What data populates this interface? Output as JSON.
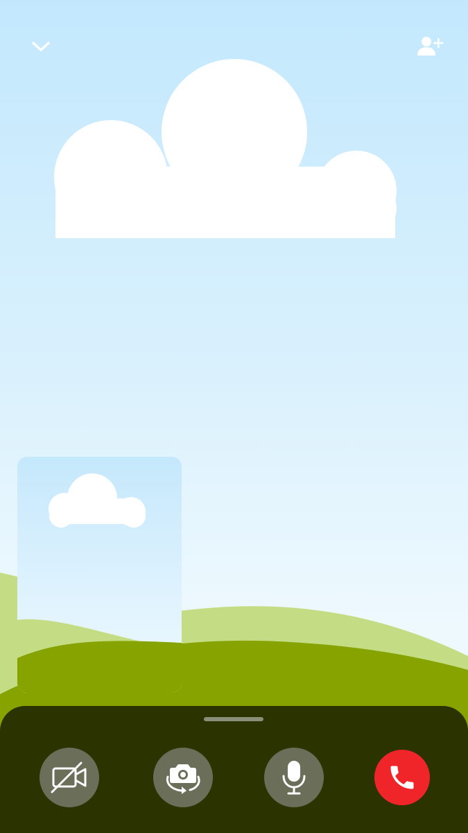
{
  "call": {
    "collapse_icon": "chevron-down-icon",
    "add_participant_icon": "add-person-icon"
  },
  "controls": [
    {
      "id": "camera",
      "icon": "camera-off-icon",
      "state": "off"
    },
    {
      "id": "flip",
      "icon": "flip-camera-icon"
    },
    {
      "id": "mic",
      "icon": "microphone-icon",
      "state": "on"
    },
    {
      "id": "end",
      "icon": "end-call-icon",
      "color": "#f0252a"
    }
  ],
  "colors": {
    "sheet": "#2b3301",
    "button": "#6b6e58",
    "end_call": "#f0252a",
    "sky_top": "#c3e8fd",
    "hill_light": "#c4dd84",
    "hill_dark": "#86a300"
  }
}
